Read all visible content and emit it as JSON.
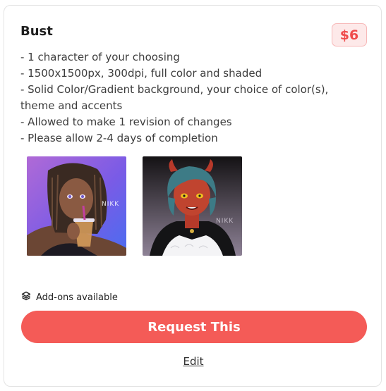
{
  "card": {
    "title": "Bust",
    "price": "$6",
    "description": [
      "- 1 character of your choosing",
      "- 1500x1500px, 300dpi, full color and shaded",
      "- Solid Color/Gradient background, your choice of color(s), theme and accents",
      "- Allowed to make 1 revision of changes",
      "- Please allow 2-4 days of completion"
    ],
    "examples": [
      {
        "name": "example-bust-1",
        "watermark": "NIKK"
      },
      {
        "name": "example-bust-2",
        "watermark": "NIKK"
      }
    ],
    "addons_label": "Add-ons available",
    "addons_icon": "layers-icon",
    "request_label": "Request This",
    "edit_label": "Edit"
  },
  "colors": {
    "accent": "#f45b57",
    "price_bg": "#fde9e9",
    "price_text": "#ef4b4b"
  }
}
